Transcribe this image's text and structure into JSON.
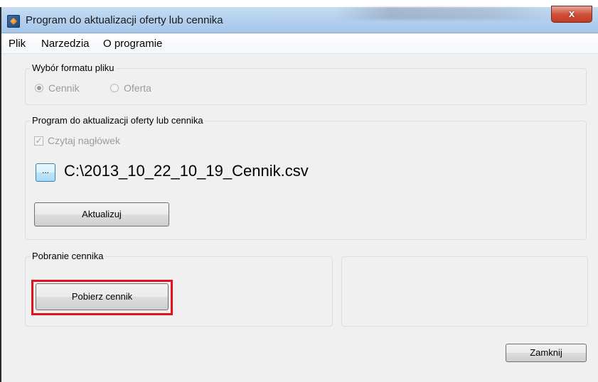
{
  "window": {
    "title": "Program do aktualizacji oferty lub cennika",
    "close_label": "x"
  },
  "menu": {
    "items": [
      "Plik",
      "Narzedzia",
      "O programie"
    ]
  },
  "format_group": {
    "legend": "Wybór formatu pliku",
    "options": [
      {
        "label": "Cennik",
        "selected": true
      },
      {
        "label": "Oferta",
        "selected": false
      }
    ]
  },
  "update_group": {
    "legend": "Program do aktualizacji oferty lub cennika",
    "read_header_label": "Czytaj nagłówek",
    "read_header_checked": true,
    "browse_label": "...",
    "file_path": "C:\\2013_10_22_10_19_Cennik.csv",
    "update_button": "Aktualizuj"
  },
  "download_group": {
    "legend": "Pobranie cennika",
    "download_button": "Pobierz cennik"
  },
  "footer": {
    "close_button": "Zamknij"
  },
  "colors": {
    "highlight": "#e0141e",
    "titlebar": "#b5d1ef",
    "close_button": "#c43a22"
  }
}
